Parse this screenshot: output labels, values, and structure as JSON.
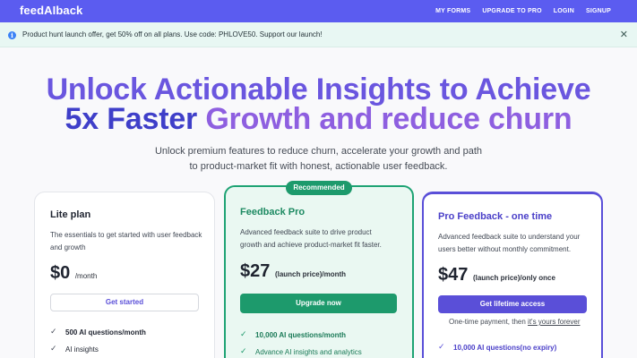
{
  "navbar": {
    "brand": "feedAIback",
    "links": [
      "MY FORMS",
      "UPGRADE TO PRO",
      "LOGIN",
      "SIGNUP"
    ]
  },
  "promo": {
    "text": "Product hunt launch offer, get 50% off on all plans. Use code: PHLOVE50. Support our launch!",
    "info_icon": "info-icon",
    "close_icon": "close-icon"
  },
  "hero": {
    "line1": "Unlock Actionable Insights to Achieve",
    "line2_accent": "5x Faster",
    "line2_rest": "Growth and reduce churn",
    "subhead": "Unlock premium features to reduce churn, accelerate your growth and path to product-market fit with honest, actionable user feedback."
  },
  "plans": {
    "lite": {
      "title": "Lite plan",
      "desc": "The essentials to get started with user feedback and growth",
      "price": "$0",
      "price_suffix": "/month",
      "button": "Get started",
      "features": [
        "500 AI questions/month",
        "AI insights"
      ]
    },
    "feedback": {
      "badge": "Recommended",
      "title": "Feedback Pro",
      "desc": "Advanced feedback suite to drive product growth and achieve product-market fit faster.",
      "price": "$27",
      "price_suffix_note": "(launch price)",
      "price_suffix": "/month",
      "button": "Upgrade now",
      "features": [
        "10,000 AI questions/month",
        "Advance AI insights and analytics"
      ]
    },
    "pro": {
      "title": "Pro Feedback - one time",
      "desc": "Advanced feedback suite to understand your users better without monthly commitment.",
      "price": "$47",
      "price_suffix_note": "(launch price)",
      "price_suffix": "/only once",
      "button": "Get lifetime access",
      "note_text": "One-time payment, then ",
      "note_link": "it's yours forever",
      "features": [
        "10,000 AI questions(no expiry)"
      ]
    }
  },
  "colors": {
    "navbar": "#5b5cf0",
    "green": "#1d9a6c",
    "purple": "#5a4fd8"
  }
}
